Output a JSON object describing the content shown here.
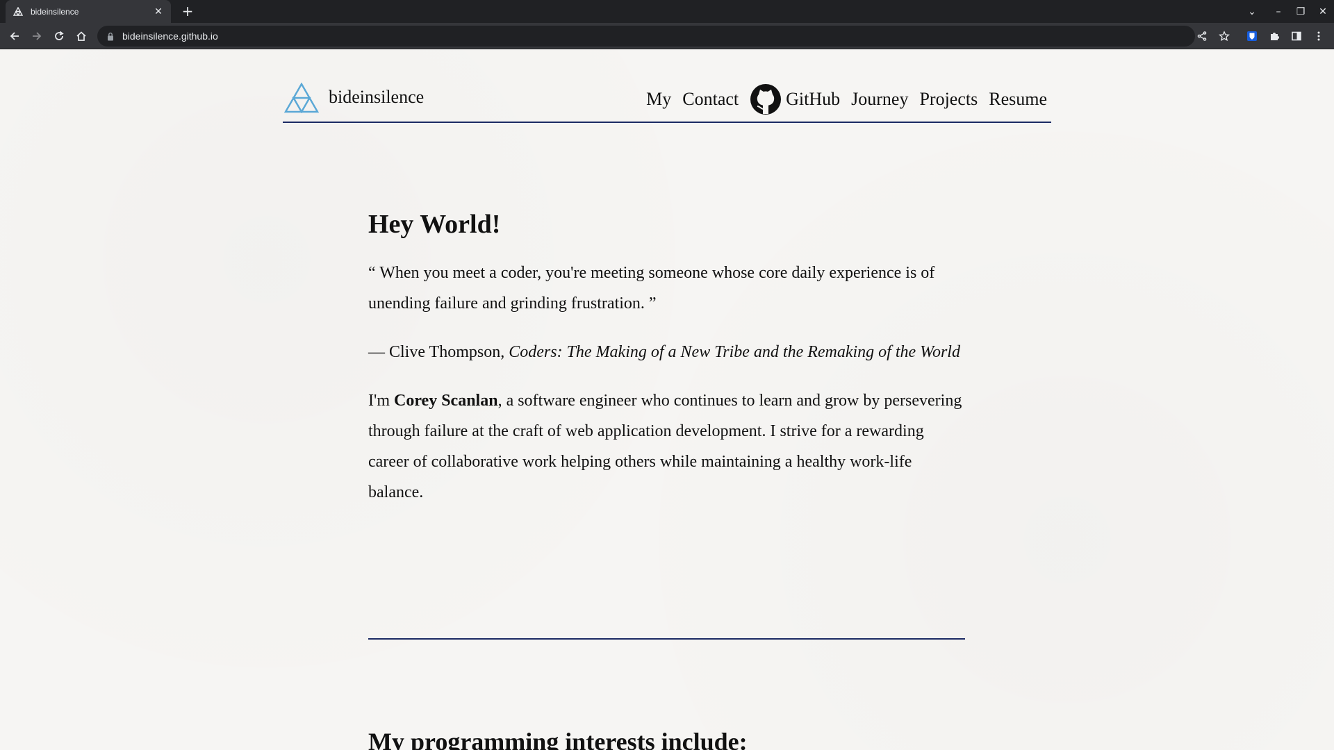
{
  "browser": {
    "tab_title": "bideinsilence",
    "tab_close": "✕",
    "new_tab": "+",
    "url": "bideinsilence.github.io",
    "window_controls": {
      "dropdown": "⌄",
      "minimize": "–",
      "restore": "❐",
      "close": "✕"
    }
  },
  "site": {
    "brand": "bideinsilence",
    "nav": {
      "my": "My",
      "contact": "Contact",
      "github": "GitHub",
      "journey": "Journey",
      "projects": "Projects",
      "resume": "Resume"
    }
  },
  "intro": {
    "heading": "Hey World!",
    "quote": "“ When you meet a coder, you're meeting someone whose core daily experience is of unending failure and grinding frustration. ”",
    "attribution_prefix": "— Clive Thompson, ",
    "attribution_book": "Coders: The Making of a New Tribe and the Remaking of the World",
    "bio_prefix": "I'm ",
    "bio_name": "Corey Scanlan",
    "bio_rest": ", a software engineer who continues to learn and grow by persevering through failure at the craft of web application development. I strive for a rewarding career of collaborative work helping others while maintaining a healthy work-life balance."
  },
  "interests": {
    "heading": "My programming interests include:"
  },
  "colors": {
    "accent": "#1b2a63",
    "logo": "#5ba8d6",
    "chrome_dark": "#202124",
    "chrome_mid": "#35363a"
  }
}
